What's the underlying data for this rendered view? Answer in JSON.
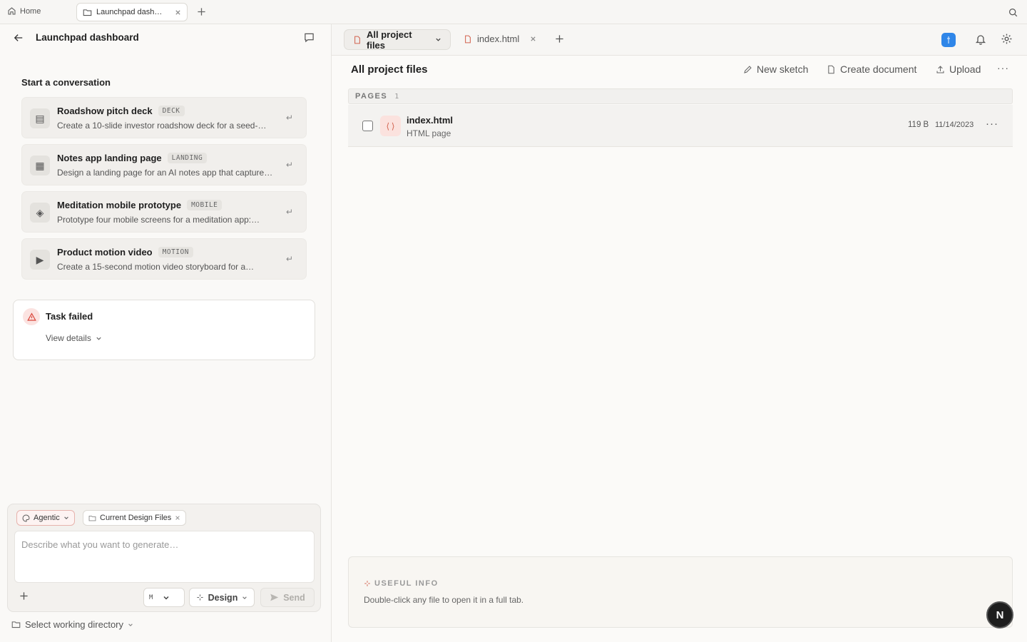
{
  "topbar": {
    "home_label": "Home",
    "active_tab_label": "Launchpad dash…"
  },
  "left": {
    "project_title": "Launchpad dashboard",
    "start_label": "Start a conversation",
    "suggestions": [
      {
        "title": "Roadshow pitch deck",
        "tag": "DECK",
        "desc": "Create a 10-slide investor roadshow deck for a seed-…",
        "icon": "slides-icon",
        "glyph": "▤"
      },
      {
        "title": "Notes app landing page",
        "tag": "LANDING",
        "desc": "Design a landing page for an AI notes app that capture…",
        "icon": "grid-icon",
        "glyph": "▦"
      },
      {
        "title": "Meditation mobile prototype",
        "tag": "MOBILE",
        "desc": "Prototype four mobile screens for a meditation app:…",
        "icon": "diamond-icon",
        "glyph": "◈"
      },
      {
        "title": "Product motion video",
        "tag": "MOTION",
        "desc": "Create a 15-second motion video storyboard for a…",
        "icon": "play-icon",
        "glyph": "▶"
      }
    ],
    "enter_glyph": "↵",
    "task_failed": {
      "title": "Task failed",
      "details_label": "View details"
    },
    "composer": {
      "mode_chip": "Agentic",
      "context_chip": "Current Design Files",
      "placeholder": "Describe what you want to generate…",
      "model_label": "M",
      "design_label": "Design",
      "send_label": "Send"
    },
    "working_dir_label": "Select working directory"
  },
  "right": {
    "tabs": [
      {
        "label": "All project files",
        "active": true
      },
      {
        "label": "index.html",
        "active": false
      }
    ],
    "section_title": "All project files",
    "actions": {
      "new_sketch": "New sketch",
      "create_document": "Create document",
      "upload": "Upload",
      "more": "···"
    },
    "pages_header": {
      "label": "PAGES",
      "count": "1"
    },
    "files": [
      {
        "name": "index.html",
        "type": "HTML page",
        "size": "119 B",
        "date": "11/14/2023",
        "icon_glyph": "⟨⟩"
      }
    ],
    "useful_info": {
      "label": "USEFUL INFO",
      "text": "Double-click any file to open it in a full tab."
    },
    "fab_label": "N"
  },
  "colors": {
    "accent": "#2f86e8",
    "error": "#d9453a",
    "html_icon": "#d26450"
  }
}
